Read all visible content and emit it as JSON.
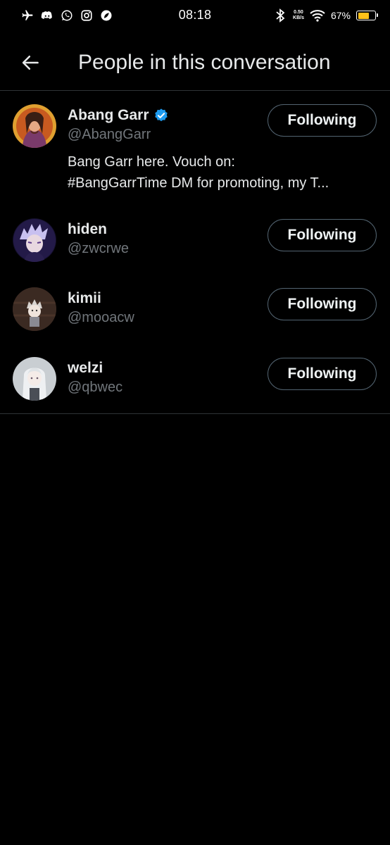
{
  "status_bar": {
    "time": "08:18",
    "left_icons": [
      "airplane-icon",
      "discord-icon",
      "whatsapp-icon",
      "instagram-icon",
      "leaf-app-icon"
    ],
    "net_speed_value": "0.50",
    "net_speed_unit": "KB/s",
    "battery_percent": "67%",
    "battery_level": 0.67
  },
  "header": {
    "title": "People in this conversation",
    "back_icon": "arrow-left-icon"
  },
  "users": [
    {
      "name": "Abang Garr",
      "verified": true,
      "handle": "@AbangGarr",
      "bio_line1": "Bang Garr here. Vouch on:",
      "bio_line2": "#BangGarrTime DM for promoting, my T...",
      "button": "Following"
    },
    {
      "name": "hiden",
      "handle": "@zwcrwe",
      "button": "Following"
    },
    {
      "name": "kimii",
      "handle": "@mooacw",
      "button": "Following"
    },
    {
      "name": "welzi",
      "handle": "@qbwec",
      "button": "Following"
    }
  ],
  "colors": {
    "background": "#000000",
    "verified": "#1d9bf0",
    "secondary_text": "#71767b",
    "battery": "#ffc11a"
  }
}
